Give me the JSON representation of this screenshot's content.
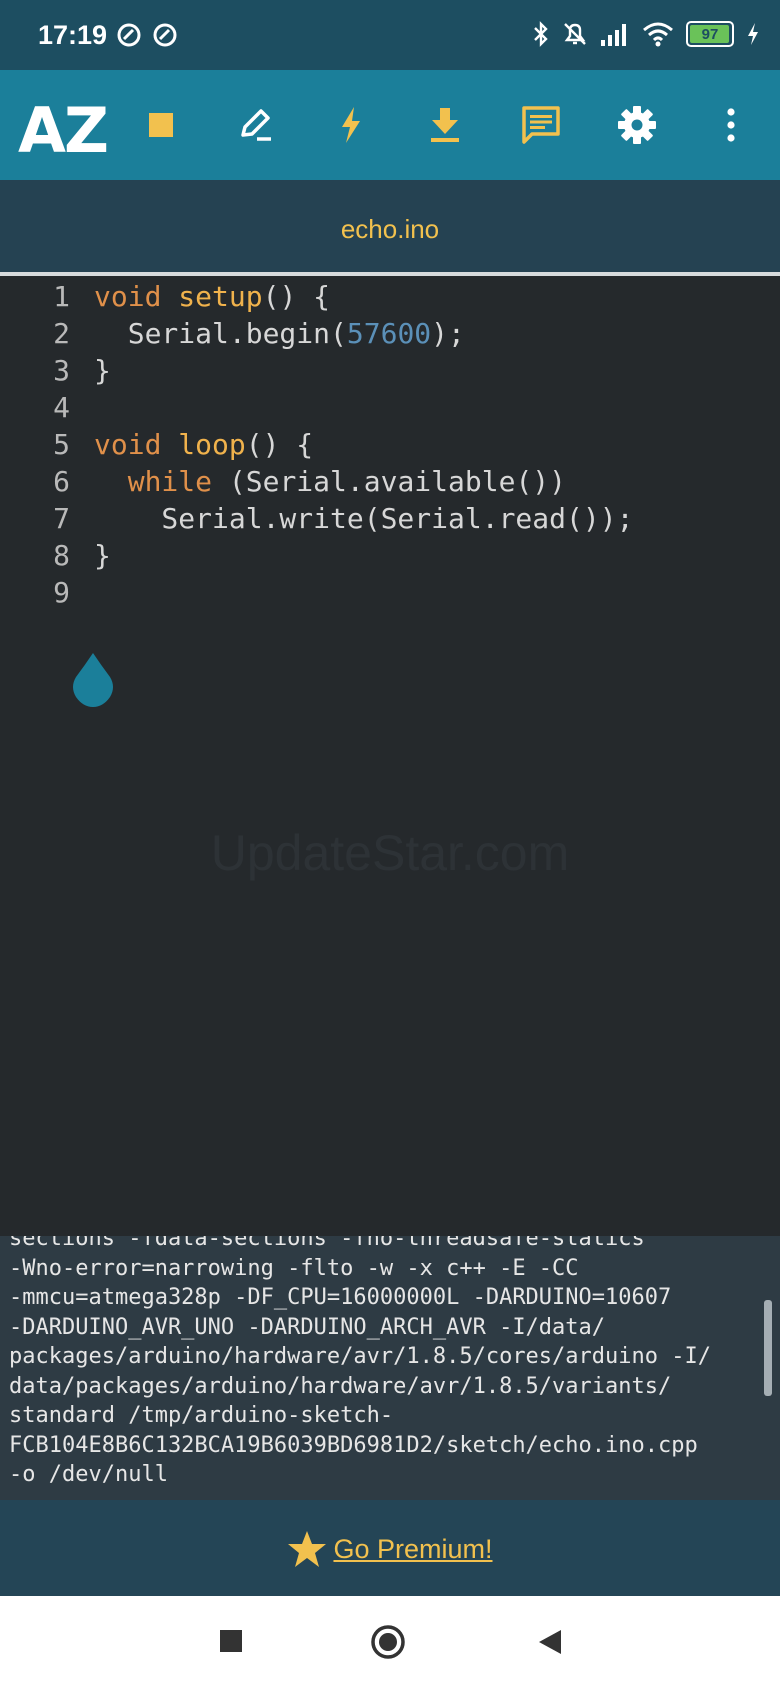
{
  "status_bar": {
    "time": "17:19",
    "battery_level": "97"
  },
  "toolbar": {
    "logo": "AZ",
    "icons": [
      "stop-icon",
      "edit-icon",
      "flash-icon",
      "download-icon",
      "message-icon",
      "settings-icon",
      "more-vert-icon"
    ],
    "accent_color": "#f2c14e"
  },
  "tab": {
    "title": "echo.ino"
  },
  "editor": {
    "line_numbers": [
      "1",
      "2",
      "3",
      "4",
      "5",
      "6",
      "7",
      "8",
      "9"
    ],
    "lines": [
      {
        "segments": [
          {
            "t": "void ",
            "c": "kw"
          },
          {
            "t": "setup",
            "c": "fn"
          },
          {
            "t": "() {",
            "c": ""
          }
        ]
      },
      {
        "segments": [
          {
            "t": "  Serial.begin(",
            "c": ""
          },
          {
            "t": "57600",
            "c": "num"
          },
          {
            "t": ");",
            "c": ""
          }
        ]
      },
      {
        "segments": [
          {
            "t": "}",
            "c": ""
          }
        ]
      },
      {
        "segments": []
      },
      {
        "segments": [
          {
            "t": "void ",
            "c": "kw"
          },
          {
            "t": "loop",
            "c": "fn"
          },
          {
            "t": "() {",
            "c": ""
          }
        ]
      },
      {
        "segments": [
          {
            "t": "  ",
            "c": ""
          },
          {
            "t": "while",
            "c": "kw"
          },
          {
            "t": " (Serial.available())",
            "c": ""
          }
        ]
      },
      {
        "segments": [
          {
            "t": "    Serial.write(Serial.read());",
            "c": ""
          }
        ]
      },
      {
        "segments": [
          {
            "t": "}",
            "c": ""
          }
        ]
      },
      {
        "segments": []
      }
    ]
  },
  "watermark": "UpdateStar.com",
  "console": {
    "lines": [
      "sections -fdata-sections -fno-threadsafe-statics",
      "-Wno-error=narrowing -flto -w -x c++ -E -CC",
      "-mmcu=atmega328p -DF_CPU=16000000L -DARDUINO=10607",
      "-DARDUINO_AVR_UNO -DARDUINO_ARCH_AVR -I/data/",
      "packages/arduino/hardware/avr/1.8.5/cores/arduino -I/",
      "data/packages/arduino/hardware/avr/1.8.5/variants/",
      "standard /tmp/arduino-sketch-",
      "FCB104E8B6C132BCA19B6039BD6981D2/sketch/echo.ino.cpp",
      "-o /dev/null"
    ]
  },
  "premium": {
    "label": "Go Premium!"
  }
}
